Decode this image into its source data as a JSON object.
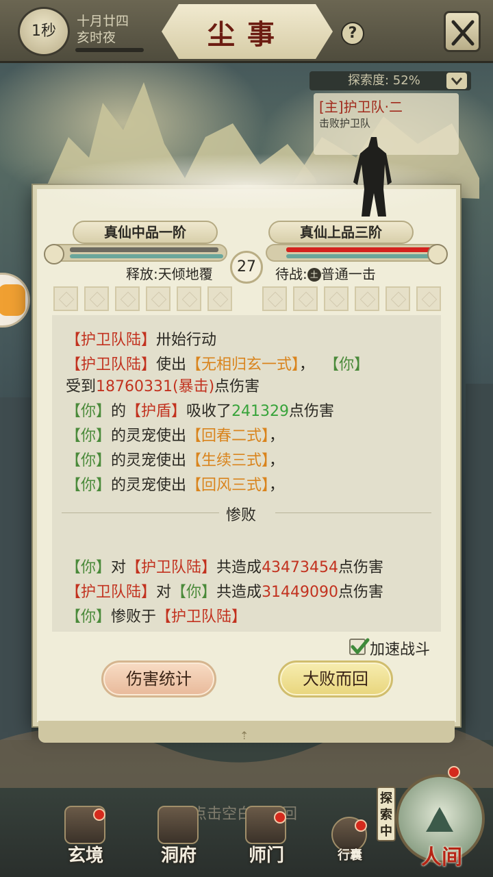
{
  "header": {
    "timer": "1秒",
    "date_line1": "十月廿四",
    "date_line2": "亥时夜",
    "title": "尘事",
    "help": "?"
  },
  "explore": {
    "label": "探索度: 52%",
    "log_line1": "[主]护卫队·二",
    "log_line2": "击败护卫队"
  },
  "battle": {
    "player_rank": "真仙中品一阶",
    "enemy_rank": "真仙上品三阶",
    "round": "27",
    "player_hp_fraction": 0.95,
    "enemy_hp_fraction": 0.95,
    "player_skill": "释放:天倾地覆",
    "enemy_wait_prefix": "待战:",
    "enemy_wait_icon": "土",
    "enemy_wait_skill": "普通一击"
  },
  "log": {
    "l1": {
      "a": "【护卫队陆】",
      "b": "卅始行动"
    },
    "l2": {
      "a": "【护卫队陆】",
      "b": "使出",
      "c": "【无相归玄一式】",
      "d": "，",
      "e": "【你】"
    },
    "l3": {
      "a": "受到",
      "b": "18760331(暴击)",
      "c": "点伤害"
    },
    "l4": {
      "a": "【你】",
      "b": "的",
      "c": "【护盾】",
      "d": "吸收了",
      "e": "241329",
      "f": "点伤害"
    },
    "l5": {
      "a": "【你】",
      "b": "的灵宠使出",
      "c": "【回春二式】",
      "d": "，"
    },
    "l6": {
      "a": "【你】",
      "b": "的灵宠使出",
      "c": "【生续三式】",
      "d": "，"
    },
    "l7": {
      "a": "【你】",
      "b": "的灵宠使出",
      "c": "【回风三式】",
      "d": "，"
    },
    "result": "惨败",
    "s1": {
      "a": "【你】",
      "b": "对",
      "c": "【护卫队陆】",
      "d": "共造成",
      "e": "43473454",
      "f": "点伤害"
    },
    "s2": {
      "a": "【护卫队陆】",
      "b": "对",
      "c": "【你】",
      "d": "共造成",
      "e": "31449090",
      "f": "点伤害"
    },
    "s3": {
      "a": "【你】",
      "b": "惨败于",
      "c": "【护卫队陆】"
    }
  },
  "controls": {
    "speed_label": "加速战斗",
    "speed_checked": true,
    "stats_button": "伤害统计",
    "retreat_button": "大败而回"
  },
  "hint": "点击空白处返回",
  "nav": {
    "xuanjing": "玄境",
    "dongfu": "洞府",
    "shimen": "师门",
    "bag": "行囊",
    "explore_tag": "探索中",
    "world": "人间"
  },
  "colors": {
    "accent_red": "#c2321f",
    "accent_green": "#4a8a3a",
    "accent_orange": "#d9841d",
    "panel_bg": "#f0edd9"
  }
}
